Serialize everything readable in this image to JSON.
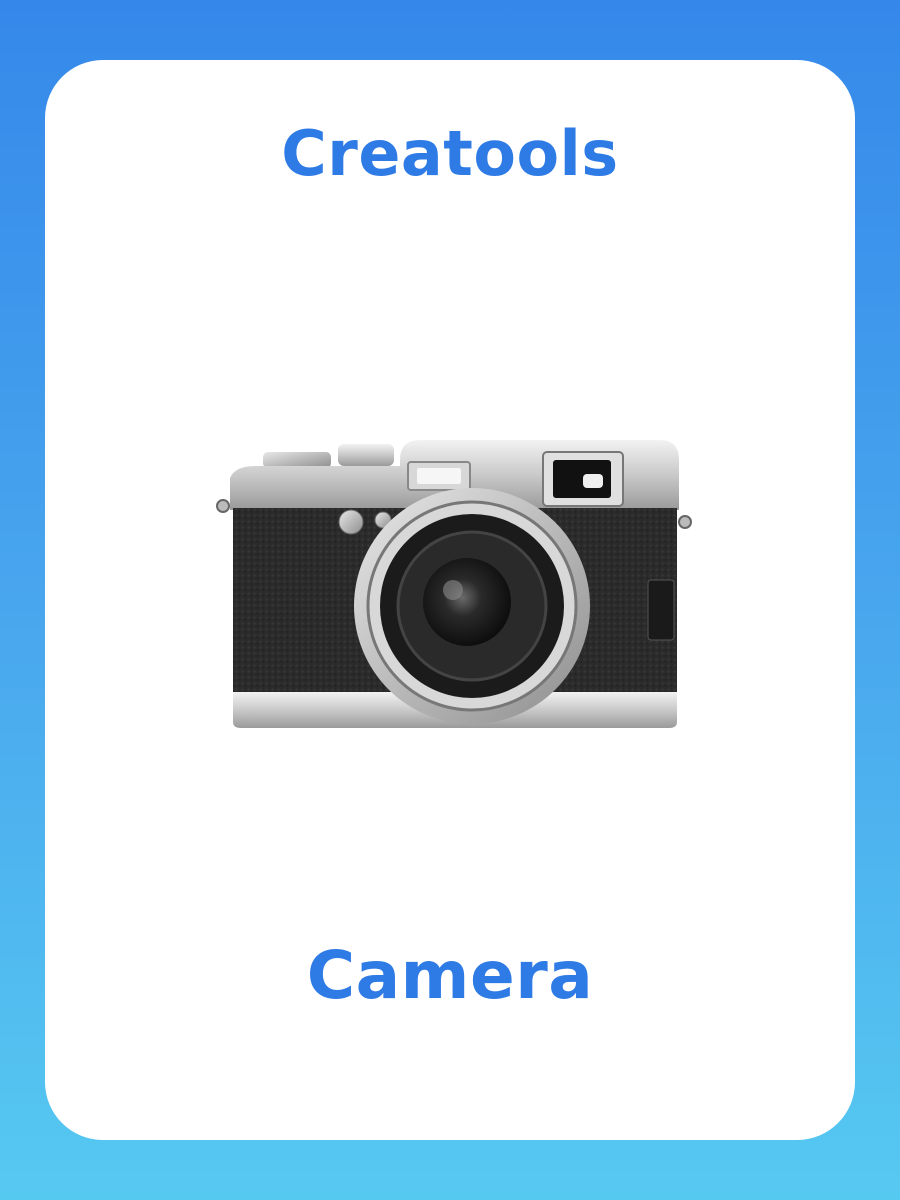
{
  "card": {
    "brand_title": "Creatools",
    "word": "Camera",
    "image_subject": "camera-photo"
  },
  "colors": {
    "accent": "#2f7be6",
    "background_top": "#3588ea",
    "background_bottom": "#56c9f1",
    "card": "#ffffff"
  }
}
